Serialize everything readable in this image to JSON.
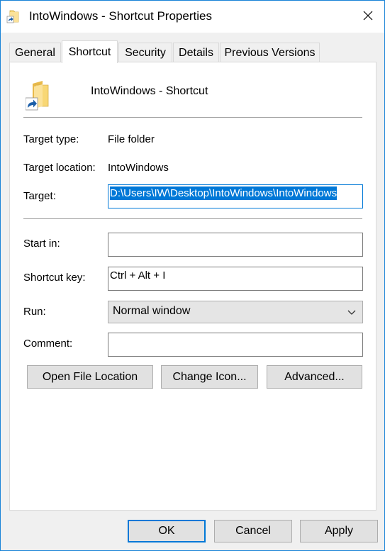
{
  "window": {
    "title": "IntoWindows - Shortcut Properties"
  },
  "tabs": [
    {
      "label": "General"
    },
    {
      "label": "Shortcut"
    },
    {
      "label": "Security"
    },
    {
      "label": "Details"
    },
    {
      "label": "Previous Versions"
    }
  ],
  "active_tab": "Shortcut",
  "shortcut": {
    "name": "IntoWindows - Shortcut",
    "target_type_label": "Target type:",
    "target_type_value": "File folder",
    "target_location_label": "Target location:",
    "target_location_value": "IntoWindows",
    "target_label": "Target:",
    "target_value": "D:\\Users\\IW\\Desktop\\IntoWindows\\IntoWindows",
    "start_in_label": "Start in:",
    "start_in_value": "",
    "shortcut_key_label": "Shortcut key:",
    "shortcut_key_value": "Ctrl + Alt + I",
    "run_label": "Run:",
    "run_value": "Normal window",
    "comment_label": "Comment:",
    "comment_value": ""
  },
  "actions": {
    "open_file_location": "Open File Location",
    "change_icon": "Change Icon...",
    "advanced": "Advanced..."
  },
  "footer": {
    "ok": "OK",
    "cancel": "Cancel",
    "apply": "Apply"
  },
  "colors": {
    "accent": "#0078d7",
    "folder": "#f8d775",
    "shortcut_arrow": "#1a5ea8"
  },
  "icons": [
    "folder-shortcut-icon",
    "close-icon",
    "chevron-down-icon"
  ]
}
